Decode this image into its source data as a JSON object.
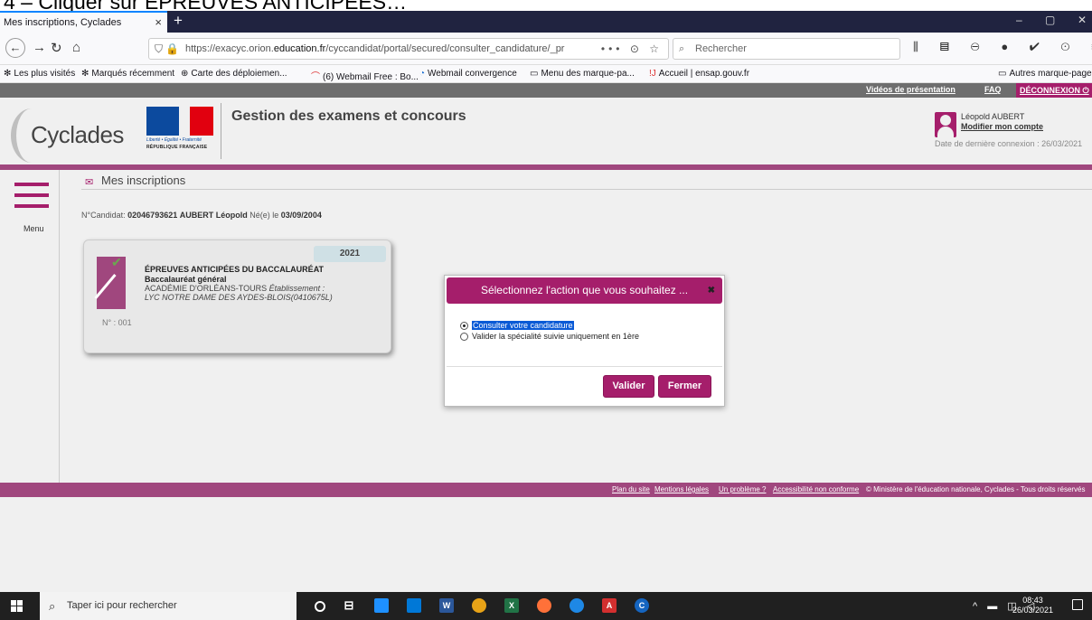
{
  "caption": {
    "text": "4 – Cliquer sur ÉPREUVES ANTICIPÉES…"
  },
  "browser": {
    "tab_title": "Mes inscriptions, Cyclades",
    "tab_close": "×",
    "new_tab": "+",
    "window_controls": [
      "–",
      "▢",
      "✕"
    ],
    "url_prefix": "https://exacyc.orion.",
    "url_domain": "education.fr",
    "url_path": "/cyccandidat/portal/secured/consulter_candidature/_pr",
    "url_more": "•••",
    "search_placeholder": "Rechercher",
    "bookmarks": [
      {
        "label": "Les plus visités",
        "icon": "gear-icon"
      },
      {
        "label": "Marqués récemment",
        "icon": "gear-icon"
      },
      {
        "label": "Carte des déploiemen...",
        "icon": "globe-icon"
      },
      {
        "label": "(6) Webmail Free : Bo...",
        "icon": "mail-icon"
      },
      {
        "label": "Webmail convergence",
        "icon": "webmail-icon"
      },
      {
        "label": "Menu des marque-pa...",
        "icon": "folder-icon"
      },
      {
        "label": "Accueil | ensap.gouv.fr",
        "icon": "ensap-icon"
      }
    ],
    "other_bookmarks": "Autres marque-pages"
  },
  "site": {
    "top_links": {
      "videos": "Vidéos de présentation",
      "faq": "FAQ",
      "logout": "DÉCONNEXION"
    },
    "logo_text": "Cyclades",
    "marianne_motto": "Liberté • Égalité • Fraternité",
    "marianne_rep": "RÉPUBLIQUE FRANÇAISE",
    "app_title": "Gestion des examens et concours",
    "user": {
      "name": "Léopold AUBERT",
      "edit_account": "Modifier mon compte",
      "last_login": "Date de dernière connexion : 26/03/2021"
    },
    "menu_label": "Menu",
    "page_title": "Mes inscriptions",
    "candidate": {
      "label": "N°Candidat:",
      "number": "02046793621",
      "name": "AUBERT Léopold",
      "born_label": "Né(e) le",
      "birth_date": "03/09/2004"
    },
    "card": {
      "year": "2021",
      "title": "ÉPREUVES ANTICIPÉES DU BACCALAURÉAT",
      "subtitle": "Baccalauréat général",
      "academy": "ACADÉMIE D'ORLÉANS-TOURS",
      "etab_label": "Établissement :",
      "etab": "LYC NOTRE DAME DES AYDES-BLOIS(0410675L)",
      "number": "N° : 001"
    },
    "modal": {
      "title": "Sélectionnez l'action que vous souhaitez ...",
      "close": "✖",
      "options": [
        {
          "label": "Consulter votre candidature",
          "selected": true
        },
        {
          "label": "Valider la spécialité suivie uniquement en 1ère",
          "selected": false
        }
      ],
      "validate": "Valider",
      "close_button": "Fermer"
    },
    "footer": {
      "links": [
        "Plan du site",
        "Mentions légales",
        "Un problème ?",
        "Accessibilité non conforme"
      ],
      "copyright": "© Ministère de l'éducation nationale, Cyclades - Tous droits réservés"
    }
  },
  "taskbar": {
    "search_placeholder": "Taper ici pour rechercher",
    "time": "08:43",
    "date": "26/03/2021"
  },
  "colors": {
    "brand": "#a51e6b",
    "brand_bar": "#a0477e",
    "selection": "#0a5ad6"
  }
}
